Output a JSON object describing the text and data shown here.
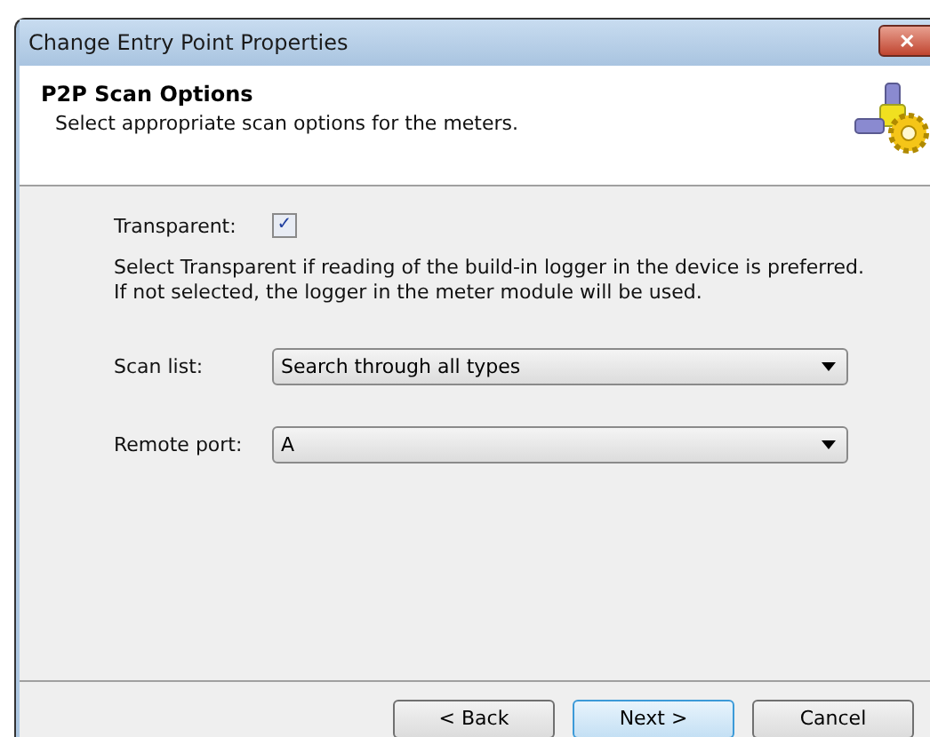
{
  "window": {
    "title": "Change Entry Point Properties",
    "close": "✕"
  },
  "header": {
    "title": "P2P Scan Options",
    "subtitle": "Select appropriate scan options for the meters."
  },
  "transparent": {
    "label": "Transparent:",
    "checked": true,
    "check": "✓"
  },
  "help": [
    "Select Transparent if reading of the build-in logger in the device is preferred.",
    "If not selected, the logger in the meter module will be used."
  ],
  "fields": [
    {
      "label": "Scan list:",
      "value": "Search through all types"
    },
    {
      "label": "Remote port:",
      "value": "A"
    }
  ],
  "buttons": [
    {
      "label": "< Back",
      "default": false
    },
    {
      "label": "Next >",
      "default": true
    },
    {
      "label": "Cancel",
      "default": false
    }
  ]
}
